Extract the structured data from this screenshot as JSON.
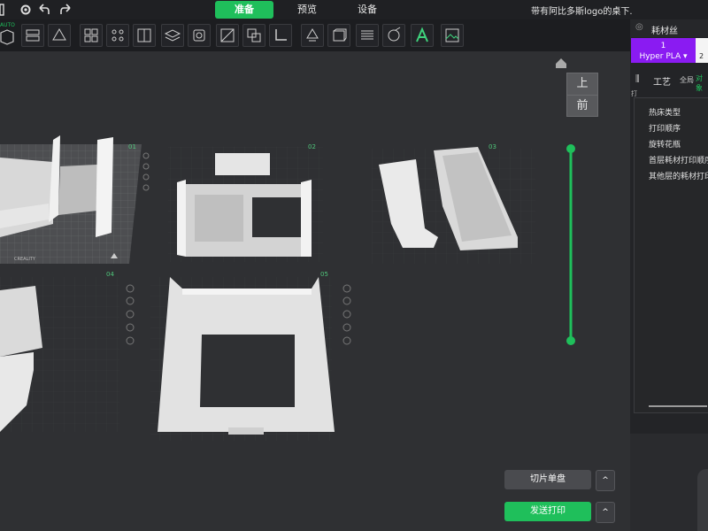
{
  "topbar": {
    "menu_icon": "menu-icon",
    "tabs": [
      {
        "label": "准备",
        "active": true
      },
      {
        "label": "预览",
        "active": false
      },
      {
        "label": "设备",
        "active": false
      }
    ],
    "project_title": "带有阿比多斯logo的桌下.",
    "colors": {
      "accent": "#1fbf5b"
    }
  },
  "toolbar": {
    "auto_label": "AUTO",
    "tool_icons": [
      "auto-arrange-icon",
      "layout-icon",
      "orient-icon",
      "grid-icon",
      "dots-icon",
      "split-icon",
      "layer-icon",
      "cube-icon",
      "cut-icon",
      "merge-icon",
      "corner-icon",
      "support-icon",
      "box-icon",
      "stack-icon",
      "paint-icon",
      "text-icon",
      "image-icon"
    ]
  },
  "viewport": {
    "plate_labels": [
      "01",
      "02",
      "03",
      "04",
      "05"
    ],
    "plate_brand": "CREALITY",
    "view_cube": {
      "top": "上",
      "front": "前"
    }
  },
  "right_panel": {
    "filament_title": "耗材丝",
    "filament_slot": {
      "index": "1",
      "name": "Hyper PLA"
    },
    "filament_slot2": "2",
    "process_title": "工艺",
    "process_scope": "全局",
    "process_scope2": "对象",
    "process_partial": "打",
    "process_items": [
      "热床类型",
      "打印顺序",
      "旋转花瓶",
      "首层耗材打印顺序",
      "其他层的耗材打印"
    ]
  },
  "actions": {
    "slice_label": "切片单盘",
    "print_label": "发送打印"
  }
}
